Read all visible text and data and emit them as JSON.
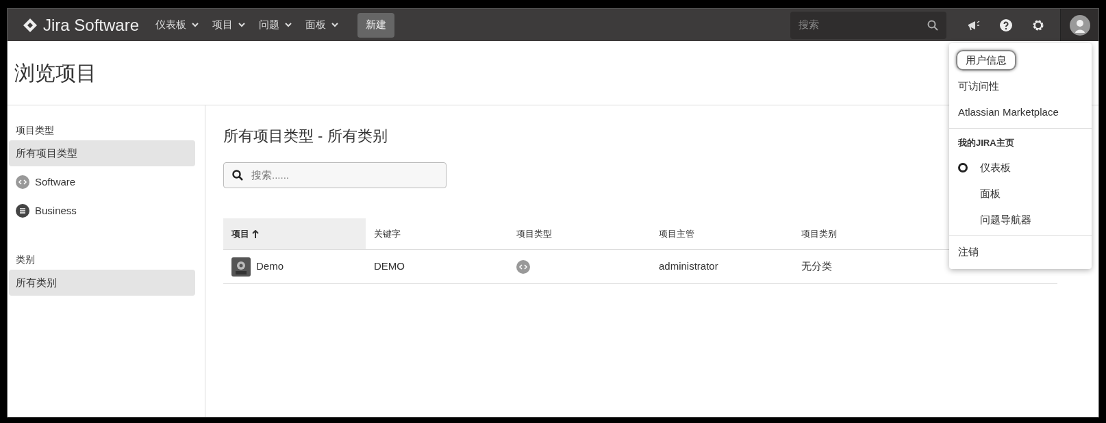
{
  "header": {
    "logo": "Jira Software",
    "nav": [
      {
        "label": "仪表板",
        "dropdown": true
      },
      {
        "label": "项目",
        "dropdown": true
      },
      {
        "label": "问题",
        "dropdown": true
      },
      {
        "label": "面板",
        "dropdown": true
      }
    ],
    "create_button": "新建",
    "search": {
      "placeholder": "搜索"
    }
  },
  "page_title": "浏览项目",
  "sidebar": {
    "sections": [
      {
        "title": "项目类型",
        "items": [
          {
            "label": "所有项目类型",
            "kind": "plain",
            "selected": true
          },
          {
            "label": "Software",
            "kind": "software",
            "selected": false
          },
          {
            "label": "Business",
            "kind": "business",
            "selected": false
          }
        ]
      },
      {
        "title": "类别",
        "items": [
          {
            "label": "所有类别",
            "kind": "plain",
            "selected": true
          }
        ]
      }
    ]
  },
  "content": {
    "title": "所有项目类型 - 所有类别",
    "search": {
      "placeholder": "搜索......"
    },
    "table": {
      "columns": [
        {
          "label": "项目",
          "sorted": true
        },
        {
          "label": "关键字",
          "sorted": false
        },
        {
          "label": "项目类型",
          "sorted": false
        },
        {
          "label": "项目主管",
          "sorted": false
        },
        {
          "label": "项目类别",
          "sorted": false
        }
      ],
      "rows": [
        {
          "project": "Demo",
          "key": "DEMO",
          "lead": "administrator",
          "category": "无分类"
        }
      ]
    }
  },
  "user_menu": {
    "items": [
      {
        "label": "用户信息",
        "kind": "item",
        "highlighted": true
      },
      {
        "label": "可访问性",
        "kind": "item",
        "highlighted": false
      },
      {
        "label": "Atlassian Marketplace",
        "kind": "item",
        "highlighted": false
      },
      {
        "kind": "divider"
      },
      {
        "label": "我的JIRA主页",
        "kind": "heading"
      },
      {
        "label": "仪表板",
        "kind": "radio",
        "selected": true
      },
      {
        "label": "面板",
        "kind": "radio",
        "selected": false
      },
      {
        "label": "问题导航器",
        "kind": "radio",
        "selected": false
      },
      {
        "kind": "divider"
      },
      {
        "label": "注销",
        "kind": "item",
        "highlighted": false
      }
    ]
  }
}
